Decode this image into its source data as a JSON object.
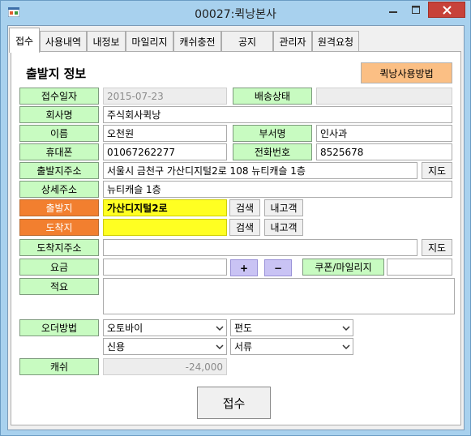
{
  "window": {
    "title": "00027:퀵낭본사"
  },
  "tabs": [
    {
      "label": "접수"
    },
    {
      "label": "사용내역"
    },
    {
      "label": "내정보"
    },
    {
      "label": "마일리지"
    },
    {
      "label": "캐쉬충전"
    },
    {
      "label": "공지"
    },
    {
      "label": "관리자"
    },
    {
      "label": "원격요청"
    }
  ],
  "form": {
    "section_title": "출발지 정보",
    "help_button": "퀵낭사용방법",
    "received_date": {
      "label": "접수일자",
      "value": "2015-07-23"
    },
    "delivery_status": {
      "label": "배송상태",
      "value": ""
    },
    "company": {
      "label": "회사명",
      "value": "주식회사퀵낭"
    },
    "name": {
      "label": "이름",
      "value": "오천원"
    },
    "department": {
      "label": "부서명",
      "value": "인사과"
    },
    "mobile": {
      "label": "휴대폰",
      "value": "01067262277"
    },
    "phone": {
      "label": "전화번호",
      "value": "8525678"
    },
    "origin_address": {
      "label": "출발지주소",
      "value": "서울시 금천구 가산디지털2로 108 뉴티캐슬 1층",
      "map_button": "지도"
    },
    "detail_address": {
      "label": "상세주소",
      "value": "뉴티캐슬 1층"
    },
    "origin": {
      "label": "출발지",
      "value": "가산디지털2로",
      "search_button": "검색",
      "customer_button": "내고객"
    },
    "destination": {
      "label": "도착지",
      "value": "",
      "search_button": "검색",
      "customer_button": "내고객"
    },
    "destination_address": {
      "label": "도착지주소",
      "value": "",
      "map_button": "지도"
    },
    "fee": {
      "label": "요금",
      "value": "",
      "plus": "+",
      "minus": "−",
      "coupon_button": "쿠폰/마일리지",
      "coupon_value": ""
    },
    "remarks": {
      "label": "적요",
      "value": ""
    },
    "order_method": {
      "label": "오더방법",
      "vehicle": "오토바이",
      "trip": "편도",
      "payment": "신용",
      "item": "서류"
    },
    "cash": {
      "label": "캐쉬",
      "value": "-24,000"
    },
    "submit_button": "접수"
  }
}
